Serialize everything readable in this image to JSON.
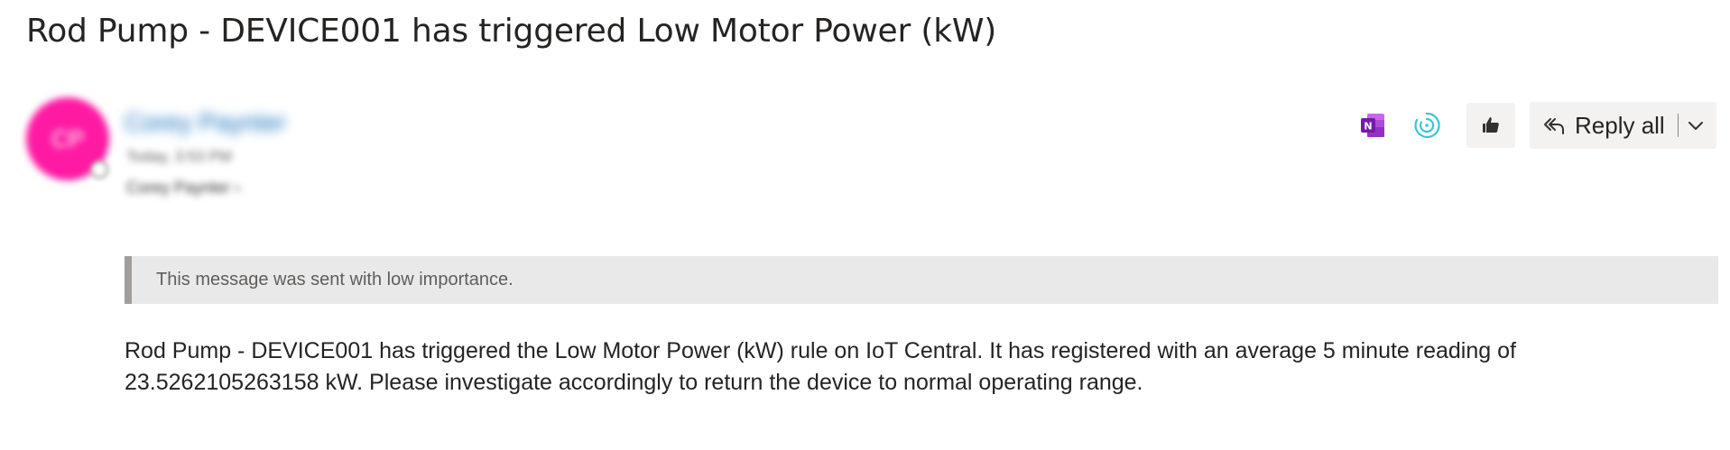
{
  "email": {
    "subject": "Rod Pump - DEVICE001 has triggered Low Motor Power (kW)",
    "sender": {
      "name": "Corey Paynter",
      "initials": "CP",
      "sent_time": "Today, 3:53 PM",
      "avatar_color": "#ff1aa3"
    },
    "recipient": "Corey Paynter",
    "importance_notice": "This message was sent with low importance.",
    "body_lines": [
      "Rod Pump - DEVICE001 has triggered the Low Motor Power (kW) rule on IoT Central. It has registered with an average 5 minute reading of",
      "23.5262105263158 kW. Please investigate accordingly to return the device to normal operating range."
    ]
  },
  "toolbar": {
    "onenote_icon": "onenote-icon",
    "viva_icon": "viva-insights-icon",
    "like_icon": "thumbs-up-icon",
    "reply_all_label": "Reply all",
    "reply_all_icon": "reply-all-icon",
    "more_icon": "chevron-down-icon"
  },
  "colors": {
    "accent": "#0f6cbd",
    "onenote": "#7719aa",
    "viva": "#3cc3d8"
  }
}
